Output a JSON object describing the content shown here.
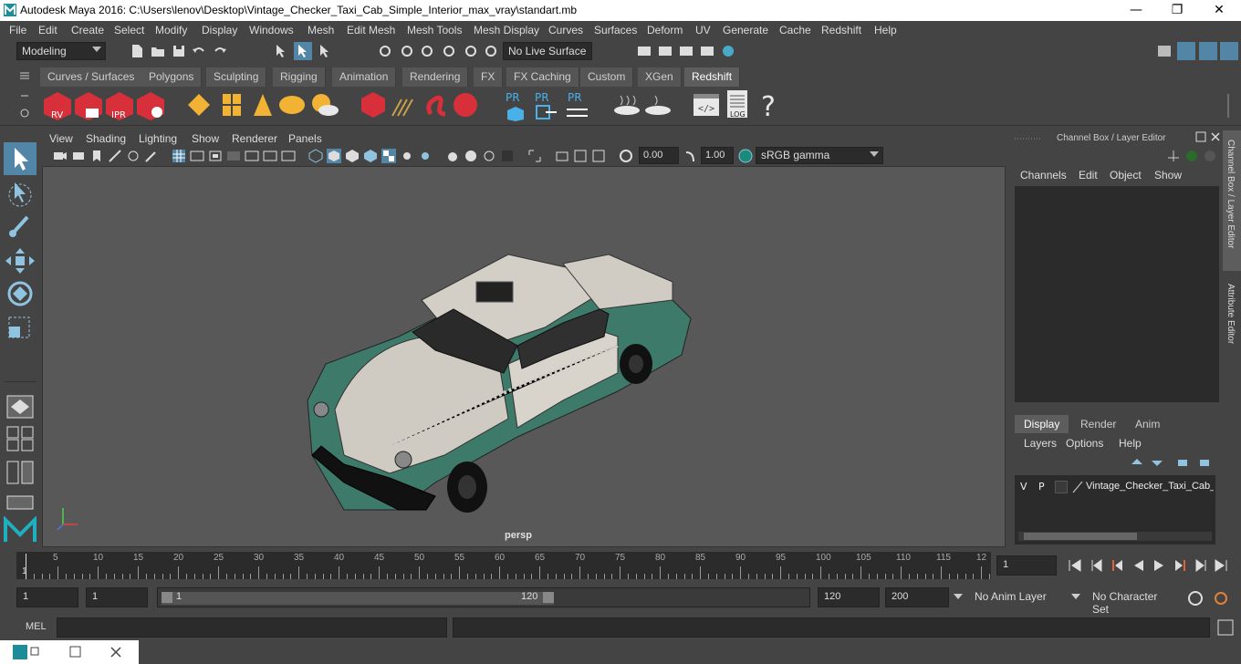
{
  "window": {
    "title": "Autodesk Maya 2016: C:\\Users\\lenov\\Desktop\\Vintage_Checker_Taxi_Cab_Simple_Interior_max_vray\\standart.mb",
    "minimize": "—",
    "maximize": "❐",
    "close": "✕"
  },
  "menubar": [
    "File",
    "Edit",
    "Create",
    "Select",
    "Modify",
    "Display",
    "Windows",
    "Mesh",
    "Edit Mesh",
    "Mesh Tools",
    "Mesh Display",
    "Curves",
    "Surfaces",
    "Deform",
    "UV",
    "Generate",
    "Cache",
    "Redshift",
    "Help"
  ],
  "statusline": {
    "mode": "Modeling",
    "live_surface": "No Live Surface"
  },
  "shelf_tabs": [
    "Curves / Surfaces",
    "Polygons",
    "Sculpting",
    "Rigging",
    "Animation",
    "Rendering",
    "FX",
    "FX Caching",
    "Custom",
    "XGen",
    "Redshift"
  ],
  "shelf_active": "Redshift",
  "shelf_icons": {
    "rv": "RV",
    "ipr": "IPR",
    "pr1": "PR",
    "pr2": "PR",
    "pr3": "PR",
    "log": "LOG",
    "help": "?"
  },
  "viewport": {
    "menu": [
      "View",
      "Shading",
      "Lighting",
      "Show",
      "Renderer",
      "Panels"
    ],
    "exposure": "0.00",
    "gamma": "1.00",
    "colorspace": "sRGB gamma",
    "camera_label": "persp"
  },
  "channel_box": {
    "title": "Channel Box / Layer Editor",
    "menu": [
      "Channels",
      "Edit",
      "Object",
      "Show"
    ],
    "layer_tabs": [
      "Display",
      "Render",
      "Anim"
    ],
    "layer_tab_active": "Display",
    "layer_menu": [
      "Layers",
      "Options",
      "Help"
    ],
    "layer": {
      "v": "V",
      "p": "P",
      "name": "Vintage_Checker_Taxi_Cab_"
    }
  },
  "side_tabs": [
    "Channel Box / Layer Editor",
    "Attribute Editor"
  ],
  "timeline": {
    "ticks": [
      "5",
      "10",
      "15",
      "20",
      "25",
      "30",
      "35",
      "40",
      "45",
      "50",
      "55",
      "60",
      "65",
      "70",
      "75",
      "80",
      "85",
      "90",
      "95",
      "100",
      "105",
      "110",
      "115",
      "12"
    ],
    "start_marker": "1",
    "current_frame": "1"
  },
  "range": {
    "start": "1",
    "start2": "1",
    "slider_start": "1",
    "slider_end": "120",
    "end": "120",
    "end2": "200",
    "anim_layer": "No Anim Layer",
    "char_set": "No Character Set"
  },
  "mel": {
    "label": "MEL"
  },
  "colors": {
    "accent": "#5285a6",
    "redshift_red": "#d8303a",
    "viewport_bg": "#585858"
  }
}
